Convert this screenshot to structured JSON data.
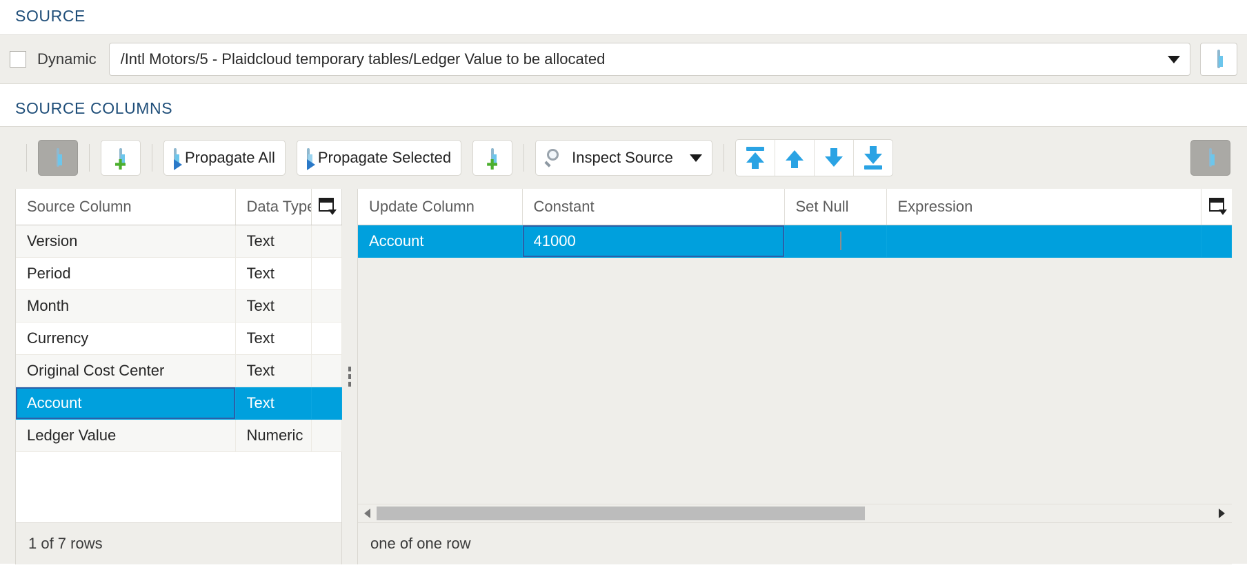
{
  "sections": {
    "source_heading": "SOURCE",
    "source_columns_heading": "SOURCE COLUMNS"
  },
  "source": {
    "dynamic_label": "Dynamic",
    "dynamic_checked": false,
    "table_path": "/Intl Motors/5 - Plaidcloud temporary tables/Ledger Value to be allocated",
    "dropdown_icon": "chevron-down-icon",
    "browse_button_icon": "table-icon"
  },
  "toolbar": {
    "show_table_icon": "table-icon",
    "add_column_icon": "table-add-icon",
    "propagate_all_label": "Propagate All",
    "propagate_all_icon": "table-arrow-icon",
    "propagate_selected_label": "Propagate Selected",
    "propagate_selected_icon": "table-rows-arrow-icon",
    "add_row_icon": "table-add-icon",
    "inspect_source_label": "Inspect Source",
    "inspect_source_icon": "magnifier-icon",
    "inspect_source_caret": "chevron-down-icon",
    "move_top_icon": "arrow-to-top-icon",
    "move_up_icon": "arrow-up-icon",
    "move_down_icon": "arrow-down-icon",
    "move_bottom_icon": "arrow-to-bottom-icon",
    "right_toggle_icon": "table-icon"
  },
  "source_columns_grid": {
    "headers": [
      "Source Column",
      "Data Type"
    ],
    "column_chooser_icon": "column-chooser-icon",
    "rows": [
      {
        "source_column": "Version",
        "data_type": "Text",
        "selected": false
      },
      {
        "source_column": "Period",
        "data_type": "Text",
        "selected": false
      },
      {
        "source_column": "Month",
        "data_type": "Text",
        "selected": false
      },
      {
        "source_column": "Currency",
        "data_type": "Text",
        "selected": false
      },
      {
        "source_column": "Original Cost Center",
        "data_type": "Text",
        "selected": false
      },
      {
        "source_column": "Account",
        "data_type": "Text",
        "selected": true
      },
      {
        "source_column": "Ledger Value",
        "data_type": "Numeric",
        "selected": false
      }
    ],
    "status": "1 of 7 rows"
  },
  "update_grid": {
    "headers": [
      "Update Column",
      "Constant",
      "Set Null",
      "Expression"
    ],
    "column_chooser_icon": "column-chooser-icon",
    "rows": [
      {
        "update_column": "Account",
        "constant": "41000",
        "set_null": false,
        "expression": "",
        "selected": true
      }
    ],
    "status": "one of one row",
    "scroll": {
      "left_arrow_icon": "chevron-left-icon",
      "right_arrow_icon": "chevron-right-icon",
      "thumb_percent": 58
    }
  },
  "colors": {
    "heading": "#1f4e79",
    "selection": "#00a0dd",
    "panel": "#efeeea",
    "focus_border": "#2b5fa8"
  }
}
